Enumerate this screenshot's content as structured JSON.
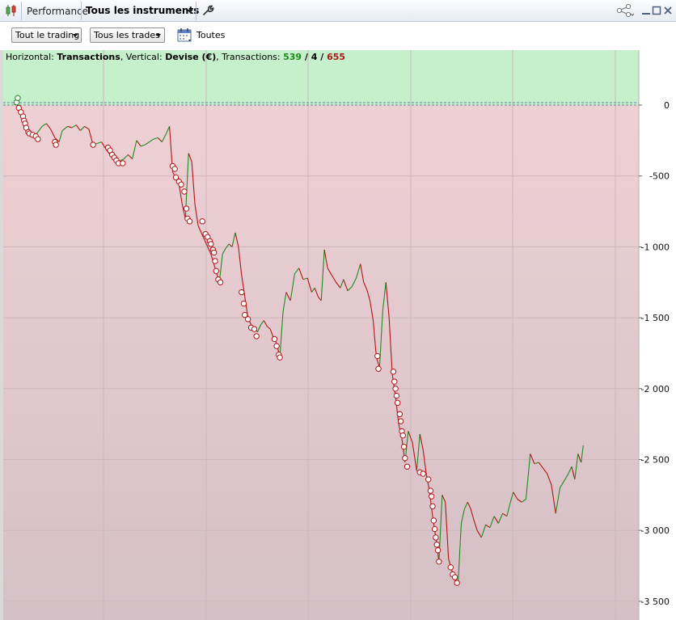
{
  "window": {
    "title": "Performance",
    "instruments_menu": "Tous les instruments"
  },
  "toolbar": {
    "trading_dropdown": "Tout le trading",
    "trades_dropdown": "Tous les trades",
    "period_label": "Toutes"
  },
  "info": {
    "horizontal_label": "Horizontal:",
    "horizontal_value": "Transactions",
    "vertical_label": ", Vertical:",
    "vertical_value": "Devise (€)",
    "transactions_label": ", Transactions:",
    "count_win": "539",
    "count_neutral": "4",
    "count_loss": "655",
    "sep": " / "
  },
  "colors": {
    "profit_zone": "#c6efcc",
    "loss_zone_top": "#eed0d4",
    "loss_zone_bottom": "#d4c0c6",
    "up": "#1f8a1f",
    "down": "#b01515"
  },
  "chart_data": {
    "type": "line",
    "title": "",
    "xlabel": "Transactions",
    "ylabel": "Devise (€)",
    "x_count": 1198,
    "ylim": [
      -3600,
      80
    ],
    "y_ticks": [
      0,
      -500,
      -1000,
      -1500,
      -2000,
      -2500,
      -3000,
      -3500
    ],
    "y_tick_labels": [
      "0",
      "-500",
      "-1 000",
      "-1 500",
      "-2 000",
      "-2 500",
      "-3 000",
      "-3 500"
    ],
    "series": [
      {
        "points": [
          [
            0,
            0
          ],
          [
            3,
            40
          ],
          [
            6,
            -10
          ],
          [
            12,
            -80
          ],
          [
            18,
            -160
          ],
          [
            24,
            -200
          ],
          [
            30,
            -210
          ],
          [
            36,
            -230
          ],
          [
            44,
            -190
          ],
          [
            52,
            -150
          ],
          [
            60,
            -130
          ],
          [
            68,
            -170
          ],
          [
            76,
            -230
          ],
          [
            84,
            -260
          ],
          [
            90,
            -180
          ],
          [
            100,
            -150
          ],
          [
            108,
            -160
          ],
          [
            116,
            -140
          ],
          [
            124,
            -180
          ],
          [
            132,
            -150
          ],
          [
            140,
            -170
          ],
          [
            148,
            -280
          ],
          [
            156,
            -270
          ],
          [
            164,
            -260
          ],
          [
            172,
            -310
          ],
          [
            180,
            -350
          ],
          [
            188,
            -380
          ],
          [
            196,
            -400
          ],
          [
            206,
            -380
          ],
          [
            214,
            -350
          ],
          [
            222,
            -380
          ],
          [
            230,
            -250
          ],
          [
            238,
            -290
          ],
          [
            246,
            -280
          ],
          [
            254,
            -260
          ],
          [
            262,
            -240
          ],
          [
            270,
            -230
          ],
          [
            278,
            -260
          ],
          [
            286,
            -200
          ],
          [
            292,
            -150
          ],
          [
            298,
            -470
          ],
          [
            304,
            -520
          ],
          [
            310,
            -560
          ],
          [
            316,
            -700
          ],
          [
            322,
            -800
          ],
          [
            328,
            -340
          ],
          [
            334,
            -400
          ],
          [
            340,
            -700
          ],
          [
            346,
            -850
          ],
          [
            352,
            -900
          ],
          [
            358,
            -950
          ],
          [
            364,
            -1000
          ],
          [
            370,
            -1050
          ],
          [
            378,
            -1150
          ],
          [
            386,
            -1250
          ],
          [
            392,
            -1050
          ],
          [
            398,
            -1010
          ],
          [
            404,
            -980
          ],
          [
            410,
            -1000
          ],
          [
            416,
            -900
          ],
          [
            422,
            -1000
          ],
          [
            428,
            -1200
          ],
          [
            434,
            -1350
          ],
          [
            440,
            -1500
          ],
          [
            446,
            -1550
          ],
          [
            452,
            -1580
          ],
          [
            458,
            -1600
          ],
          [
            464,
            -1550
          ],
          [
            470,
            -1520
          ],
          [
            476,
            -1560
          ],
          [
            482,
            -1580
          ],
          [
            488,
            -1640
          ],
          [
            494,
            -1680
          ],
          [
            500,
            -1780
          ],
          [
            506,
            -1460
          ],
          [
            512,
            -1320
          ],
          [
            520,
            -1380
          ],
          [
            528,
            -1190
          ],
          [
            536,
            -1150
          ],
          [
            544,
            -1230
          ],
          [
            552,
            -1220
          ],
          [
            560,
            -1320
          ],
          [
            566,
            -1290
          ],
          [
            572,
            -1350
          ],
          [
            578,
            -1380
          ],
          [
            584,
            -1020
          ],
          [
            590,
            -1150
          ],
          [
            598,
            -1200
          ],
          [
            606,
            -1250
          ],
          [
            614,
            -1290
          ],
          [
            620,
            -1230
          ],
          [
            628,
            -1310
          ],
          [
            636,
            -1280
          ],
          [
            644,
            -1220
          ],
          [
            652,
            -1120
          ],
          [
            658,
            -1250
          ],
          [
            664,
            -1300
          ],
          [
            670,
            -1380
          ],
          [
            676,
            -1520
          ],
          [
            682,
            -1780
          ],
          [
            688,
            -1850
          ],
          [
            694,
            -1450
          ],
          [
            700,
            -1250
          ],
          [
            706,
            -1500
          ],
          [
            712,
            -1900
          ],
          [
            718,
            -2050
          ],
          [
            724,
            -2250
          ],
          [
            730,
            -2350
          ],
          [
            736,
            -2520
          ],
          [
            742,
            -2300
          ],
          [
            750,
            -2380
          ],
          [
            758,
            -2580
          ],
          [
            764,
            -2320
          ],
          [
            770,
            -2430
          ],
          [
            776,
            -2600
          ],
          [
            782,
            -2720
          ],
          [
            788,
            -2900
          ],
          [
            794,
            -3050
          ],
          [
            800,
            -3220
          ],
          [
            806,
            -2750
          ],
          [
            812,
            -2800
          ],
          [
            818,
            -3200
          ],
          [
            824,
            -3280
          ],
          [
            830,
            -3350
          ],
          [
            836,
            -3380
          ],
          [
            842,
            -2950
          ],
          [
            848,
            -2850
          ],
          [
            854,
            -2800
          ],
          [
            860,
            -2850
          ],
          [
            866,
            -2930
          ],
          [
            872,
            -3000
          ],
          [
            880,
            -3050
          ],
          [
            888,
            -2960
          ],
          [
            896,
            -2980
          ],
          [
            904,
            -2900
          ],
          [
            912,
            -2950
          ],
          [
            920,
            -2880
          ],
          [
            928,
            -2900
          ],
          [
            934,
            -2810
          ],
          [
            940,
            -2730
          ],
          [
            948,
            -2780
          ],
          [
            956,
            -2800
          ],
          [
            964,
            -2780
          ],
          [
            972,
            -2460
          ],
          [
            980,
            -2530
          ],
          [
            988,
            -2520
          ],
          [
            996,
            -2560
          ],
          [
            1004,
            -2600
          ],
          [
            1012,
            -2680
          ],
          [
            1020,
            -2880
          ],
          [
            1028,
            -2700
          ],
          [
            1036,
            -2650
          ],
          [
            1044,
            -2600
          ],
          [
            1050,
            -2550
          ],
          [
            1056,
            -2640
          ],
          [
            1062,
            -2460
          ],
          [
            1068,
            -2520
          ],
          [
            1072,
            -2400
          ]
        ]
      }
    ],
    "loss_markers": [
      [
        8,
        -20
      ],
      [
        12,
        -50
      ],
      [
        16,
        -80
      ],
      [
        18,
        -110
      ],
      [
        20,
        -130
      ],
      [
        22,
        -160
      ],
      [
        26,
        -190
      ],
      [
        28,
        -200
      ],
      [
        34,
        -210
      ],
      [
        40,
        -220
      ],
      [
        44,
        -240
      ],
      [
        76,
        -260
      ],
      [
        78,
        -280
      ],
      [
        148,
        -280
      ],
      [
        176,
        -300
      ],
      [
        180,
        -320
      ],
      [
        184,
        -350
      ],
      [
        188,
        -370
      ],
      [
        192,
        -390
      ],
      [
        196,
        -410
      ],
      [
        204,
        -410
      ],
      [
        298,
        -430
      ],
      [
        302,
        -450
      ],
      [
        304,
        -510
      ],
      [
        310,
        -540
      ],
      [
        314,
        -560
      ],
      [
        320,
        -610
      ],
      [
        324,
        -730
      ],
      [
        326,
        -800
      ],
      [
        330,
        -820
      ],
      [
        354,
        -820
      ],
      [
        360,
        -910
      ],
      [
        364,
        -930
      ],
      [
        368,
        -960
      ],
      [
        370,
        -980
      ],
      [
        374,
        -1020
      ],
      [
        376,
        -1040
      ],
      [
        378,
        -1100
      ],
      [
        380,
        -1170
      ],
      [
        384,
        -1230
      ],
      [
        388,
        -1250
      ],
      [
        428,
        -1320
      ],
      [
        432,
        -1400
      ],
      [
        434,
        -1480
      ],
      [
        440,
        -1510
      ],
      [
        446,
        -1570
      ],
      [
        452,
        -1580
      ],
      [
        456,
        -1630
      ],
      [
        490,
        -1650
      ],
      [
        494,
        -1700
      ],
      [
        498,
        -1760
      ],
      [
        500,
        -1780
      ],
      [
        684,
        -1770
      ],
      [
        686,
        -1860
      ],
      [
        714,
        -1880
      ],
      [
        716,
        -1950
      ],
      [
        718,
        -2000
      ],
      [
        720,
        -2050
      ],
      [
        722,
        -2100
      ],
      [
        726,
        -2180
      ],
      [
        728,
        -2230
      ],
      [
        730,
        -2300
      ],
      [
        732,
        -2330
      ],
      [
        734,
        -2410
      ],
      [
        736,
        -2490
      ],
      [
        740,
        -2550
      ],
      [
        764,
        -2590
      ],
      [
        770,
        -2600
      ],
      [
        780,
        -2640
      ],
      [
        784,
        -2720
      ],
      [
        786,
        -2760
      ],
      [
        788,
        -2830
      ],
      [
        790,
        -2930
      ],
      [
        792,
        -2990
      ],
      [
        794,
        -3050
      ],
      [
        796,
        -3100
      ],
      [
        798,
        -3140
      ],
      [
        800,
        -3220
      ],
      [
        822,
        -3260
      ],
      [
        826,
        -3310
      ],
      [
        830,
        -3330
      ],
      [
        834,
        -3370
      ]
    ],
    "win_markers": [
      [
        4,
        20
      ],
      [
        6,
        50
      ]
    ]
  }
}
